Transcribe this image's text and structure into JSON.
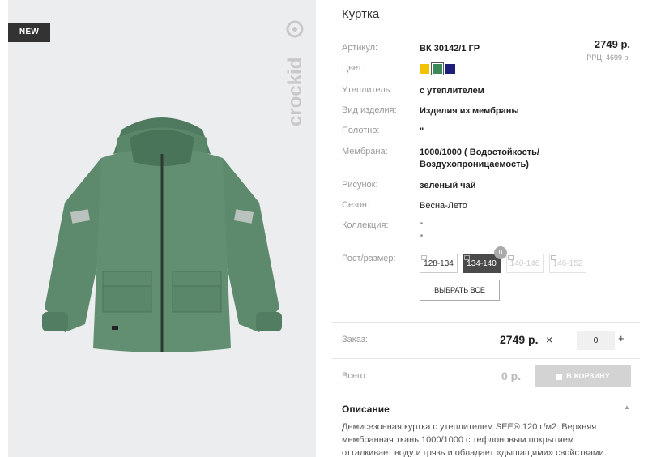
{
  "badge": "NEW",
  "brand": "crockid",
  "product": {
    "title": "Куртка",
    "price": "2749 р.",
    "rrc": "РРЦ: 4699 р."
  },
  "specs": {
    "article_label": "Артикул:",
    "article_value": "ВК 30142/1 ГР",
    "color_label": "Цвет:",
    "insulation_label": "Утеплитель:",
    "insulation_value": "с утеплителем",
    "type_label": "Вид изделия:",
    "type_value": "Изделия из мембраны",
    "fabric_label": "Полотно:",
    "fabric_value": "\"",
    "membrane_label": "Мембрана:",
    "membrane_value": "1000/1000 ( Водостойкость/ Воздухопроницаемость)",
    "pattern_label": "Рисунок:",
    "pattern_value": "зеленый чай",
    "season_label": "Сезон:",
    "season_value": "Весна-Лето",
    "collection_label": "Коллекция:",
    "collection_value": "\" \"",
    "size_label": "Рост/размер:"
  },
  "colors": [
    "#f2c200",
    "#3c8a5a",
    "#1d1f7a"
  ],
  "sizes": [
    {
      "label": "128-134",
      "state": "available"
    },
    {
      "label": "134-140",
      "state": "selected"
    },
    {
      "label": "140-146",
      "state": "disabled"
    },
    {
      "label": "146-152",
      "state": "disabled"
    }
  ],
  "size_badge": "0",
  "select_all_label": "ВЫБРАТЬ ВСЕ",
  "order": {
    "label": "Заказ:",
    "price": "2749 р.",
    "times": "×",
    "minus": "–",
    "quantity": "0",
    "plus": "+"
  },
  "total": {
    "label": "Всего:",
    "value": "0 р.",
    "cart_label": "В КОРЗИНУ"
  },
  "description": {
    "title": "Описание",
    "text": "Демисезонная куртка с утеплителем SEE® 120 г/м2. Верхняя мембранная ткань 1000/1000 с тефлоновым покрытием отталкивает воду и грязь и обладает «дышащими» свойствами. Подкладка из"
  }
}
